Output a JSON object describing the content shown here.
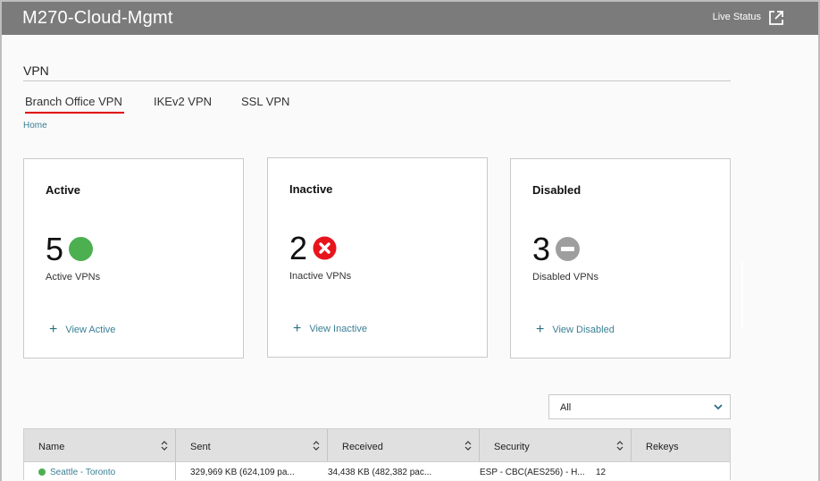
{
  "header": {
    "app_title": "M270-Cloud-Mgmt",
    "live_status_label": "Live Status",
    "external_link_icon": "external-link-icon"
  },
  "section": {
    "title": "VPN"
  },
  "tabs": [
    {
      "label": "Branch Office VPN",
      "active": true
    },
    {
      "label": "IKEv2 VPN",
      "active": false
    },
    {
      "label": "SSL VPN",
      "active": false
    }
  ],
  "breadcrumb": {
    "home_label": "Home"
  },
  "cards": [
    {
      "title": "Active",
      "count": "5",
      "subtitle": "Active VPNs",
      "link_label": "View Active",
      "icon": "green-circle-icon",
      "icon_color": "#4caf50"
    },
    {
      "title": "Inactive",
      "count": "2",
      "subtitle": "Inactive VPNs",
      "link_label": "View Inactive",
      "icon": "red-x-circle-icon",
      "icon_color": "#e8141b"
    },
    {
      "title": "Disabled",
      "count": "3",
      "subtitle": "Disabled VPNs",
      "link_label": "View Disabled",
      "icon": "gray-minus-circle-icon",
      "icon_color": "#9e9e9e"
    }
  ],
  "filter": {
    "selected": "All"
  },
  "table": {
    "columns": [
      "Name",
      "Sent",
      "Received",
      "Security",
      "Rekeys"
    ],
    "rows": [
      {
        "status_color": "#4caf50",
        "name": "Seattle - Toronto",
        "sent": "329,969 KB (624,109 pa...",
        "received": "34,438 KB (482,382 pac...",
        "security": "ESP - CBC(AES256) - H...",
        "rekeys": "12"
      }
    ]
  },
  "colors": {
    "header_bg": "#7b7b7b",
    "accent_link": "#3a7f94",
    "tab_underline": "#e00000"
  }
}
